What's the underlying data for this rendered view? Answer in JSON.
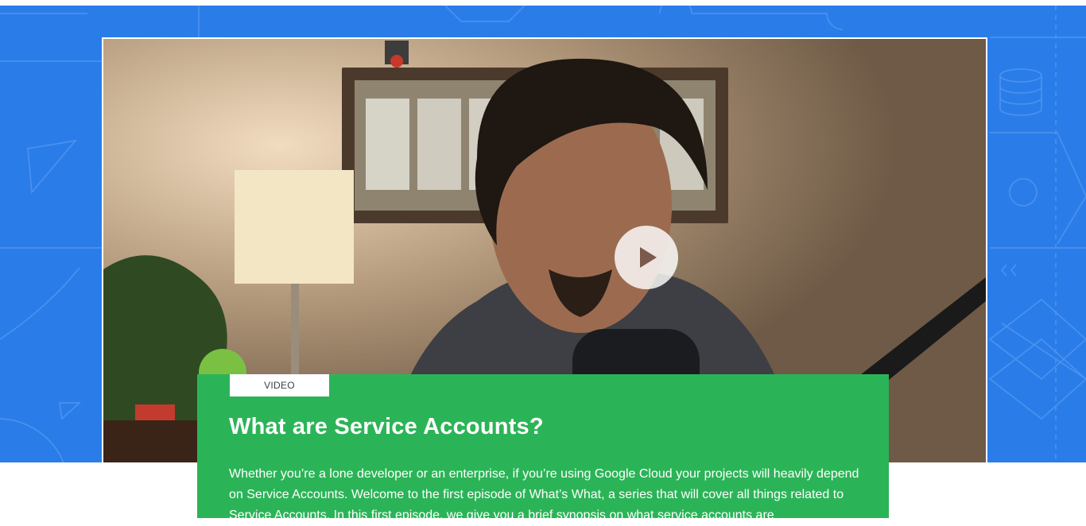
{
  "colors": {
    "hero_background": "#2a7de9",
    "card_background": "#2bb457",
    "tag_background": "#ffffff",
    "text_on_card": "#ffffff"
  },
  "video": {
    "play_icon": "play-icon"
  },
  "card": {
    "tag": "VIDEO",
    "title": "What are Service Accounts?",
    "description": "Whether you’re a lone developer or an enterprise, if you’re using Google Cloud your projects will heavily depend on Service Accounts. Welcome to the first episode of What’s What, a series that will cover all things related to Service Accounts. In this first episode, we give you a brief synopsis on what service accounts are"
  }
}
